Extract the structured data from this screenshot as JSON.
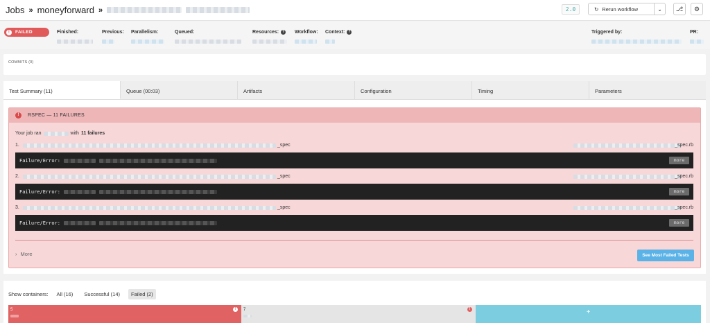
{
  "header": {
    "jobs": "Jobs",
    "sep1": "»",
    "project": "moneyforward",
    "sep2": "»",
    "version": "2.0",
    "rerun_label": "Rerun workflow",
    "rerun_icon": "refresh-icon",
    "caret": "⌄",
    "git_icon": "⎇",
    "settings_icon": "⚙"
  },
  "meta": {
    "status": "FAILED",
    "labels": {
      "finished": "Finished:",
      "previous": "Previous:",
      "parallelism": "Parallelism:",
      "queued": "Queued:",
      "resources": "Resources:",
      "workflow": "Workflow:",
      "context": "Context:",
      "triggered_by": "Triggered by:",
      "pr": "PR:"
    },
    "help": "?"
  },
  "commits": {
    "label": "COMMITS (0)"
  },
  "tabs": [
    "Test Summary (11)",
    "Queue (00:03)",
    "Artifacts",
    "Configuration",
    "Timing",
    "Parameters"
  ],
  "rspec": {
    "title": "RSPEC — 11 FAILURES",
    "ran_prefix": "Your job ran",
    "ran_mid": "with",
    "ran_count": "11 failures",
    "failures": [
      {
        "num": "1.",
        "suffix": "_spec",
        "file_suffix": "_spec.rb",
        "error_label": "Failure/Error:",
        "more": "more"
      },
      {
        "num": "2.",
        "suffix": "_spec",
        "file_suffix": "_spec.rb",
        "error_label": "Failure/Error:",
        "more": "more"
      },
      {
        "num": "3.",
        "suffix": "_spec",
        "file_suffix": "_spec.rb",
        "error_label": "Failure/Error:",
        "more": "more"
      }
    ],
    "more_link": "More",
    "more_chevron": "›",
    "see_button": "See Most Failed Tests"
  },
  "containers": {
    "label": "Show containers:",
    "filters": [
      "All (16)",
      "Successful (14)",
      "Failed (2)"
    ],
    "items": [
      {
        "num": "5",
        "status_color": "#e06262"
      },
      {
        "num": "7",
        "status_color": "#e5e5e5"
      }
    ],
    "add": "+"
  },
  "colors": {
    "failed": "#e05a5a",
    "rspec_bg": "#f7d7d8",
    "accent_blue": "#5bb2e6",
    "add_bar": "#7ccde0"
  }
}
